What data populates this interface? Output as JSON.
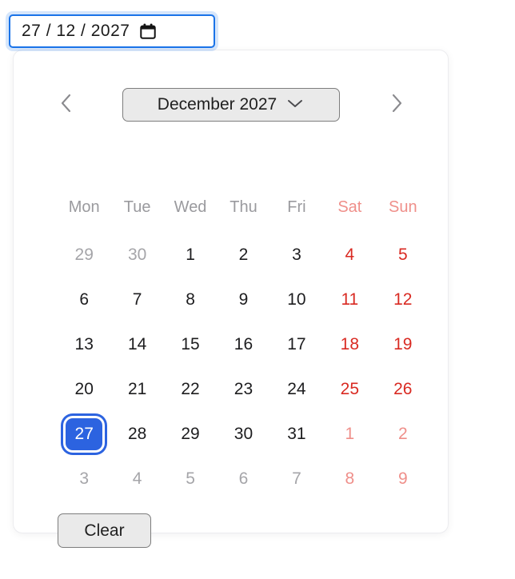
{
  "input": {
    "value": "27 / 12 / 2027",
    "placeholder": "dd / mm / yyyy",
    "icon": "calendar-icon"
  },
  "calendar": {
    "header": {
      "prev_icon": "chevron-left-icon",
      "next_icon": "chevron-right-icon",
      "month_year_label": "December 2027",
      "dropdown_icon": "chevron-down-icon"
    },
    "weekdays": [
      {
        "label": "Mon",
        "weekend": false
      },
      {
        "label": "Tue",
        "weekend": false
      },
      {
        "label": "Wed",
        "weekend": false
      },
      {
        "label": "Thu",
        "weekend": false
      },
      {
        "label": "Fri",
        "weekend": false
      },
      {
        "label": "Sat",
        "weekend": true
      },
      {
        "label": "Sun",
        "weekend": true
      }
    ],
    "weeks": [
      [
        {
          "day": "29",
          "outside": true,
          "weekend": false,
          "selected": false
        },
        {
          "day": "30",
          "outside": true,
          "weekend": false,
          "selected": false
        },
        {
          "day": "1",
          "outside": false,
          "weekend": false,
          "selected": false
        },
        {
          "day": "2",
          "outside": false,
          "weekend": false,
          "selected": false
        },
        {
          "day": "3",
          "outside": false,
          "weekend": false,
          "selected": false
        },
        {
          "day": "4",
          "outside": false,
          "weekend": true,
          "selected": false
        },
        {
          "day": "5",
          "outside": false,
          "weekend": true,
          "selected": false
        }
      ],
      [
        {
          "day": "6",
          "outside": false,
          "weekend": false,
          "selected": false
        },
        {
          "day": "7",
          "outside": false,
          "weekend": false,
          "selected": false
        },
        {
          "day": "8",
          "outside": false,
          "weekend": false,
          "selected": false
        },
        {
          "day": "9",
          "outside": false,
          "weekend": false,
          "selected": false
        },
        {
          "day": "10",
          "outside": false,
          "weekend": false,
          "selected": false
        },
        {
          "day": "11",
          "outside": false,
          "weekend": true,
          "selected": false
        },
        {
          "day": "12",
          "outside": false,
          "weekend": true,
          "selected": false
        }
      ],
      [
        {
          "day": "13",
          "outside": false,
          "weekend": false,
          "selected": false
        },
        {
          "day": "14",
          "outside": false,
          "weekend": false,
          "selected": false
        },
        {
          "day": "15",
          "outside": false,
          "weekend": false,
          "selected": false
        },
        {
          "day": "16",
          "outside": false,
          "weekend": false,
          "selected": false
        },
        {
          "day": "17",
          "outside": false,
          "weekend": false,
          "selected": false
        },
        {
          "day": "18",
          "outside": false,
          "weekend": true,
          "selected": false
        },
        {
          "day": "19",
          "outside": false,
          "weekend": true,
          "selected": false
        }
      ],
      [
        {
          "day": "20",
          "outside": false,
          "weekend": false,
          "selected": false
        },
        {
          "day": "21",
          "outside": false,
          "weekend": false,
          "selected": false
        },
        {
          "day": "22",
          "outside": false,
          "weekend": false,
          "selected": false
        },
        {
          "day": "23",
          "outside": false,
          "weekend": false,
          "selected": false
        },
        {
          "day": "24",
          "outside": false,
          "weekend": false,
          "selected": false
        },
        {
          "day": "25",
          "outside": false,
          "weekend": true,
          "selected": false
        },
        {
          "day": "26",
          "outside": false,
          "weekend": true,
          "selected": false
        }
      ],
      [
        {
          "day": "27",
          "outside": false,
          "weekend": false,
          "selected": true
        },
        {
          "day": "28",
          "outside": false,
          "weekend": false,
          "selected": false
        },
        {
          "day": "29",
          "outside": false,
          "weekend": false,
          "selected": false
        },
        {
          "day": "30",
          "outside": false,
          "weekend": false,
          "selected": false
        },
        {
          "day": "31",
          "outside": false,
          "weekend": false,
          "selected": false
        },
        {
          "day": "1",
          "outside": true,
          "weekend": true,
          "selected": false
        },
        {
          "day": "2",
          "outside": true,
          "weekend": true,
          "selected": false
        }
      ],
      [
        {
          "day": "3",
          "outside": true,
          "weekend": false,
          "selected": false
        },
        {
          "day": "4",
          "outside": true,
          "weekend": false,
          "selected": false
        },
        {
          "day": "5",
          "outside": true,
          "weekend": false,
          "selected": false
        },
        {
          "day": "6",
          "outside": true,
          "weekend": false,
          "selected": false
        },
        {
          "day": "7",
          "outside": true,
          "weekend": false,
          "selected": false
        },
        {
          "day": "8",
          "outside": true,
          "weekend": true,
          "selected": false
        },
        {
          "day": "9",
          "outside": true,
          "weekend": true,
          "selected": false
        }
      ]
    ],
    "clear_label": "Clear"
  },
  "colors": {
    "accent": "#2c63e0",
    "focus_ring": "#1a73e8",
    "weekend": "#d92a22",
    "weekend_muted": "#ef8f8a",
    "outside": "#a5a5a9",
    "button_bg": "#eaeaea"
  }
}
